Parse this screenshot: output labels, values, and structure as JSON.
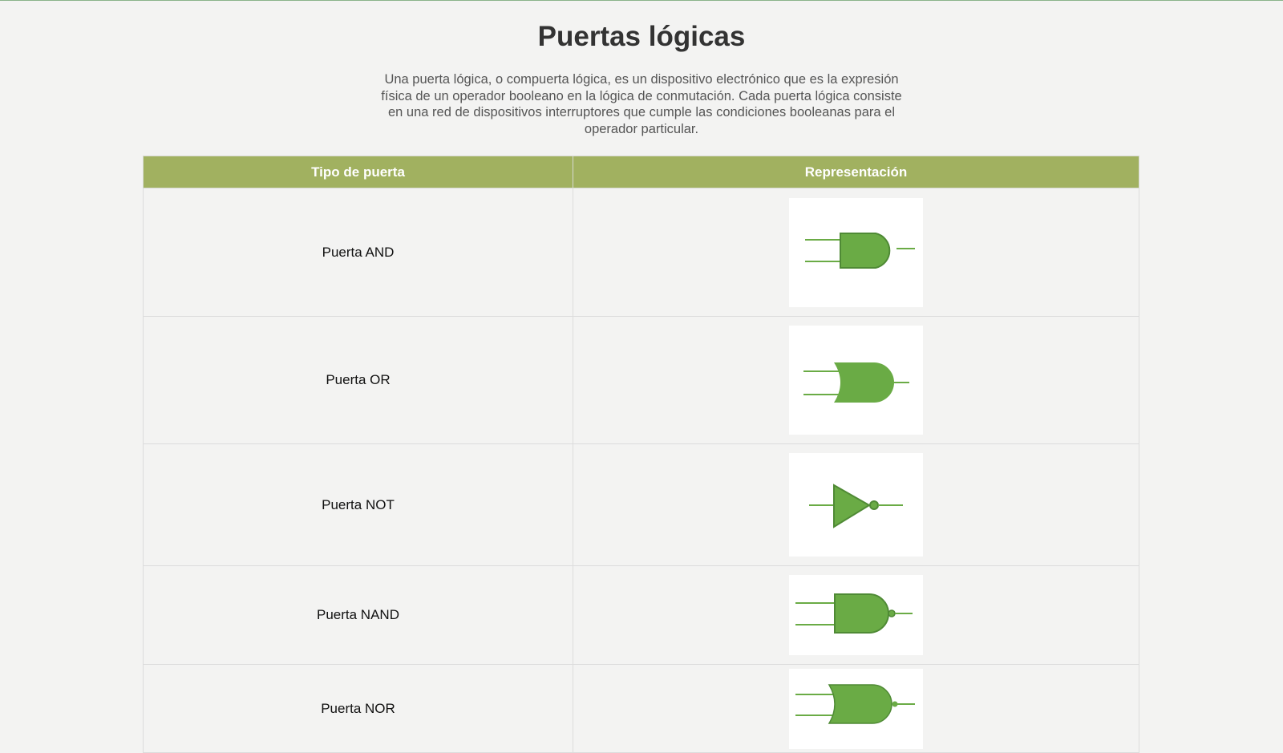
{
  "page": {
    "title": "Puertas lógicas",
    "intro": "Una puerta lógica, o compuerta lógica, es un dispositivo electrónico que es la expresión física de un operador booleano en la lógica de conmutación. Cada puerta lógica consiste en una red de dispositivos interruptores que cumple las condiciones booleanas para el operador particular."
  },
  "table": {
    "headers": [
      "Tipo de puerta",
      "Representación"
    ],
    "rows": [
      {
        "type": "Puerta AND",
        "icon": "and-gate-icon"
      },
      {
        "type": "Puerta OR",
        "icon": "or-gate-icon"
      },
      {
        "type": "Puerta NOT",
        "icon": "not-gate-icon"
      },
      {
        "type": "Puerta NAND",
        "icon": "nand-gate-icon"
      },
      {
        "type": "Puerta NOR",
        "icon": "nor-gate-icon"
      }
    ]
  },
  "colors": {
    "header_bg": "#a1b160",
    "gate_fill": "#6aab45",
    "gate_stroke": "#4f8a35",
    "wire": "#6aab45"
  }
}
